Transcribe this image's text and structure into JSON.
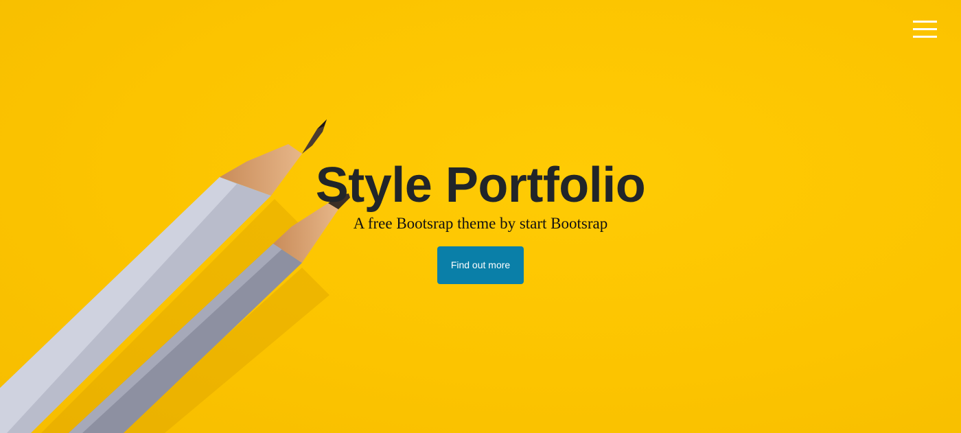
{
  "header": {
    "menu_icon": "hamburger-menu-icon"
  },
  "hero": {
    "title": "Style Portfolio",
    "subtitle": "A free Bootsrap theme by start Bootsrap",
    "cta_label": "Find out more",
    "background_image": "two-gray-pencils-on-yellow-paper"
  },
  "colors": {
    "background": "#fcc501",
    "title": "#212529",
    "button": "#0a7fa8",
    "button_text": "#ffffff",
    "menu_icon": "#ffffff"
  }
}
